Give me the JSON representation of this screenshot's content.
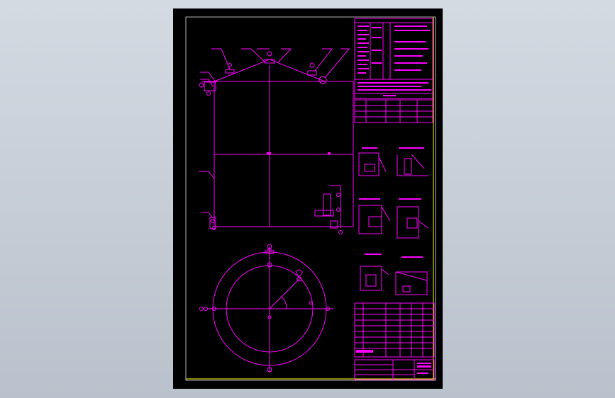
{
  "viewport": {
    "background": "#c8cfd8"
  },
  "colors": {
    "drawing": "#ff00ff",
    "border": "#ffff00",
    "sheet": "#000000"
  },
  "tank": {
    "nozzle_count_top": 5,
    "vertical_divisions": 2,
    "horizontal_divisions": 2
  },
  "plan_view": {
    "rings": 2,
    "nozzles_marked": 6
  }
}
